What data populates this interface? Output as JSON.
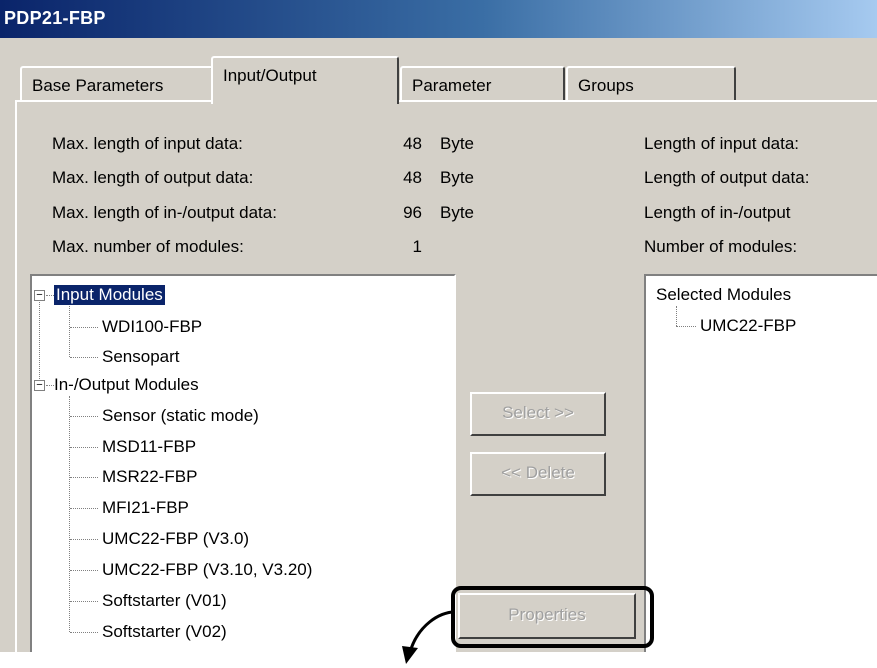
{
  "window": {
    "title": "PDP21-FBP"
  },
  "tabs": [
    {
      "label": "Base Parameters"
    },
    {
      "label": "Input/Output"
    },
    {
      "label": "Parameter"
    },
    {
      "label": "Groups"
    }
  ],
  "limits": [
    {
      "label": "Max. length of input data:",
      "value": "48",
      "unit": "Byte"
    },
    {
      "label": "Max. length of output data:",
      "value": "48",
      "unit": "Byte"
    },
    {
      "label": "Max. length of in-/output data:",
      "value": "96",
      "unit": "Byte"
    },
    {
      "label": "Max. number of modules:",
      "value": "1",
      "unit": ""
    }
  ],
  "current": [
    {
      "label": "Length of input data:"
    },
    {
      "label": "Length of output data:"
    },
    {
      "label": "Length of in-/output"
    },
    {
      "label": "Number of modules:"
    }
  ],
  "available_tree": {
    "input_group": "Input Modules",
    "input_items": [
      "WDI100-FBP",
      "Sensopart"
    ],
    "io_group": "In-/Output Modules",
    "io_items": [
      "Sensor (static mode)",
      "MSD11-FBP",
      "MSR22-FBP",
      "MFI21-FBP",
      "UMC22-FBP (V3.0)",
      "UMC22-FBP (V3.10, V3.20)",
      "Softstarter (V01)",
      "Softstarter (V02)"
    ]
  },
  "selected_tree": {
    "root": "Selected Modules",
    "items": [
      "UMC22-FBP"
    ]
  },
  "buttons": {
    "select": "Select >>",
    "delete": "<< Delete",
    "properties": "Properties"
  },
  "icons": {
    "expander_minus": "minus-box-icon",
    "callout_arrow": "curved-arrow-icon"
  }
}
